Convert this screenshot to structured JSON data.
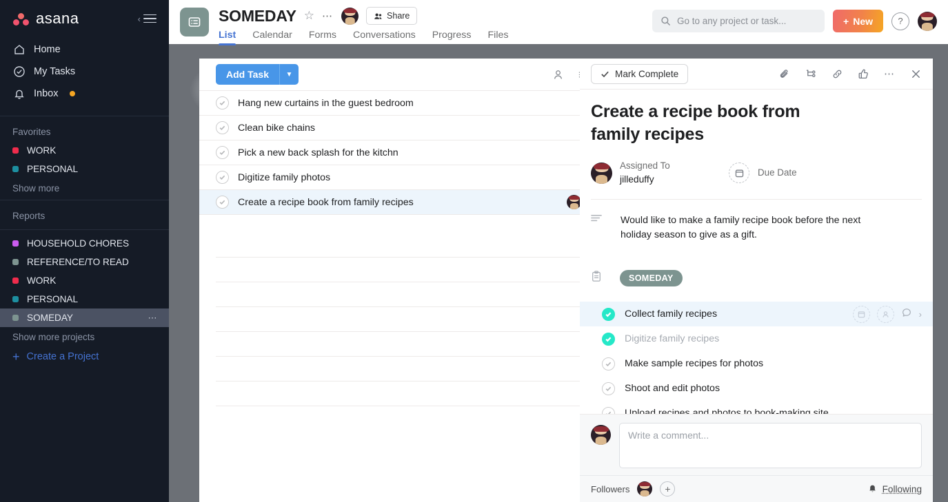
{
  "sidebar": {
    "brand": "asana",
    "collapse_icon": "hamburger-icon",
    "nav": [
      {
        "label": "Home",
        "icon": "home-icon",
        "badge": ""
      },
      {
        "label": "My Tasks",
        "icon": "check-circle-icon",
        "badge": ""
      },
      {
        "label": "Inbox",
        "icon": "bell-icon",
        "badge": "unread-dot"
      }
    ],
    "favorites_label": "Favorites",
    "favorites": [
      {
        "label": "WORK",
        "color": "#ef2c4c"
      },
      {
        "label": "PERSONAL",
        "color": "#1d8fa0"
      }
    ],
    "show_more": "Show more",
    "reports_label": "Reports",
    "projects": [
      {
        "label": "HOUSEHOLD CHORES",
        "color": "#cb5cf0",
        "active": false
      },
      {
        "label": "REFERENCE/TO READ",
        "color": "#7d9490",
        "active": false
      },
      {
        "label": "WORK",
        "color": "#ef2c4c",
        "active": false
      },
      {
        "label": "PERSONAL",
        "color": "#1d8fa0",
        "active": false
      },
      {
        "label": "SOMEDAY",
        "color": "#7d9490",
        "active": true
      }
    ],
    "project_menu_icon": "ellipsis-icon",
    "show_more_projects": "Show more projects",
    "create_project": "Create a Project"
  },
  "header": {
    "project_icon": "list-board-icon",
    "project_title": "SOMEDAY",
    "star_icon": "star-outline-icon",
    "more_icon": "ellipsis-icon",
    "member_avatar": "user-avatar",
    "share_label": "Share",
    "share_icon": "people-icon",
    "tabs": [
      {
        "label": "List",
        "active": true
      },
      {
        "label": "Calendar",
        "active": false
      },
      {
        "label": "Forms",
        "active": false
      },
      {
        "label": "Conversations",
        "active": false
      },
      {
        "label": "Progress",
        "active": false
      },
      {
        "label": "Files",
        "active": false
      }
    ],
    "search_placeholder": "Go to any project or task...",
    "search_value": "",
    "search_icon": "search-icon",
    "new_button": "New",
    "new_button_plus": "+",
    "help_label": "?",
    "account_avatar": "account-avatar"
  },
  "list": {
    "add_task_label": "Add Task",
    "add_task_caret_icon": "chevron-down-icon",
    "assignee_filter_icon": "person-icon",
    "sort_filter_icon": "sliders-icon",
    "tasks": [
      {
        "title": "Hang new curtains in the guest bedroom",
        "completed": false,
        "selected": false,
        "avatar": false
      },
      {
        "title": "Clean bike chains",
        "completed": false,
        "selected": false,
        "avatar": false
      },
      {
        "title": "Pick a new back splash for the kitchn",
        "completed": false,
        "selected": false,
        "avatar": false
      },
      {
        "title": "Digitize family photos",
        "completed": false,
        "selected": false,
        "avatar": false
      },
      {
        "title": "Create a recipe book from family recipes",
        "completed": false,
        "selected": true,
        "avatar": true
      }
    ],
    "empty_rows": 7
  },
  "detail": {
    "mark_complete_label": "Mark Complete",
    "mark_complete_icon": "check-icon",
    "toolbar_icons": [
      "paperclip-icon",
      "subtask-icon",
      "link-icon",
      "thumbs-up-icon",
      "ellipsis-icon",
      "close-icon"
    ],
    "task_title": "Create a recipe book from family recipes",
    "assignee_label": "Assigned To",
    "assignee_name": "jilleduffy",
    "assignee_avatar": "user-avatar",
    "due_date_label": "Due Date",
    "due_date_icon": "calendar-icon",
    "description_icon": "description-lines-icon",
    "description": "Would like to make a family recipe book before the next holiday season to give as a gift.",
    "project_tag_icon": "clipboard-icon",
    "project_tag": "SOMEDAY",
    "subtasks": [
      {
        "title": "Collect family recipes",
        "completed": true,
        "selected": true,
        "muted": false
      },
      {
        "title": "Digitize family recipes",
        "completed": true,
        "selected": false,
        "muted": true
      },
      {
        "title": "Make sample recipes for photos",
        "completed": false,
        "selected": false,
        "muted": false
      },
      {
        "title": "Shoot and edit photos",
        "completed": false,
        "selected": false,
        "muted": false
      },
      {
        "title": "Upload recipes and photos to book-making site",
        "completed": false,
        "selected": false,
        "muted": false
      }
    ],
    "subtask_row_icons": [
      "calendar-icon",
      "person-icon",
      "comment-icon"
    ],
    "comment_placeholder": "Write a comment...",
    "comment_value": "",
    "comment_avatar": "user-avatar",
    "followers_label": "Followers",
    "follower_avatar": "user-avatar",
    "add_follower_label": "+",
    "following_label": "Following",
    "following_icon": "bell-icon"
  },
  "colors": {
    "accent_blue": "#4573d2",
    "add_task_blue": "#4896e8",
    "complete_green": "#25e8c8",
    "project_sage": "#7d9490",
    "sidebar_bg": "#151b26"
  }
}
